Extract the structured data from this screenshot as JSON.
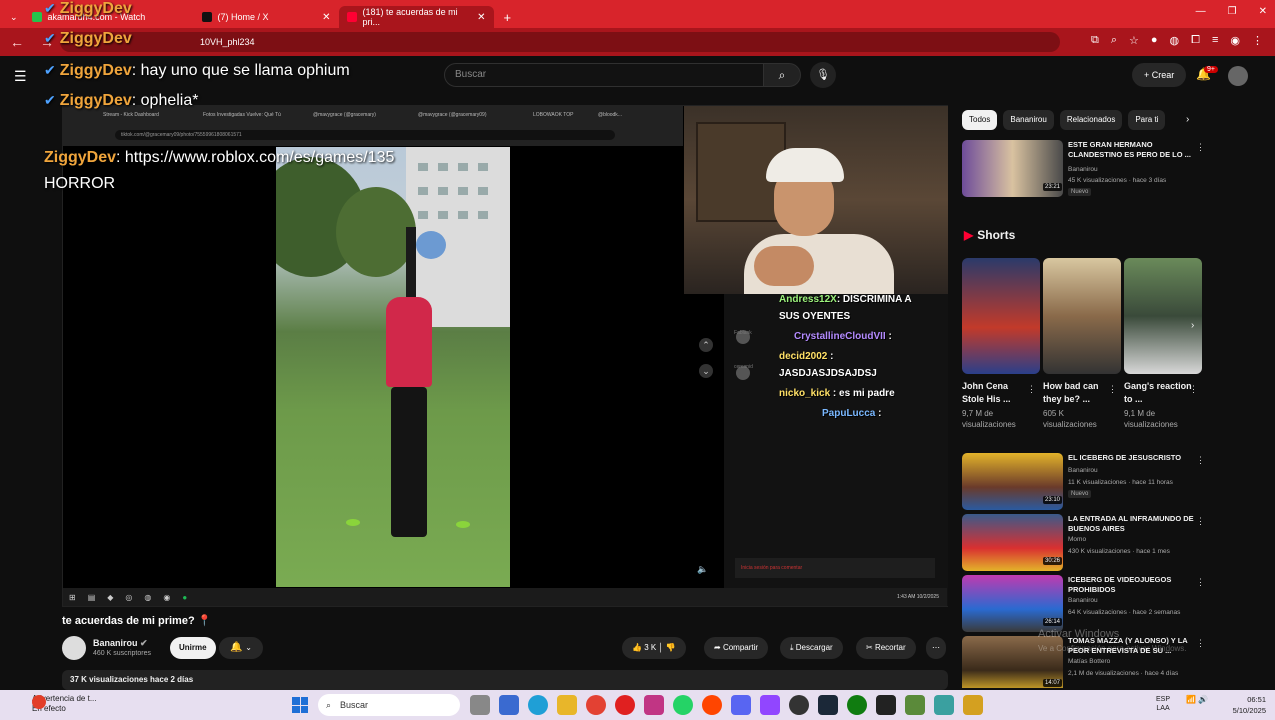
{
  "browser": {
    "tabs": [
      {
        "label": "akamaruh4.com - Watch",
        "color": "#27c24c"
      },
      {
        "label": "(7) Home / X",
        "color": "#111111"
      },
      {
        "label": "(181) te acuerdas de mi pri...",
        "color": "#ff0033"
      }
    ],
    "url_visible": "10VH_phl234"
  },
  "overlay_chat": [
    {
      "user": "ZiggyDev",
      "text": ""
    },
    {
      "user": "ZiggyDev",
      "text": ""
    },
    {
      "user": "ZiggyDev",
      "text": ": hay uno que se llama ophium"
    },
    {
      "user": "ZiggyDev",
      "text": ": ophelia*"
    },
    {
      "user": "ZiggyDev",
      "text": ": https://www.roblox.com/es/games/135"
    },
    {
      "user": "",
      "text": "HORROR"
    }
  ],
  "youtube": {
    "search_placeholder": "Buscar",
    "create_label": "Crear",
    "notif_badge": "9+"
  },
  "player": {
    "inner_tabs": [
      "Stream - Kick Dashboard",
      "Fotos Investigadas Vuelve: Qué Tú",
      "@mavygrace (@gracemary)",
      "@mavygrace (@gracemary09)",
      "LOBOWAOK TOP",
      "@bloodk..."
    ],
    "inner_url": "tiktok.com/@gracemary09/photo/75559961808061571",
    "chat": [
      {
        "user": "Andress12X",
        "text": ": DISCRIMINA A"
      },
      {
        "user": "",
        "text": "SUS OYENTES"
      },
      {
        "user": "CrystallineCloudVII",
        "text": " :"
      },
      {
        "user": "decid2002",
        "text": " :"
      },
      {
        "user": "",
        "text": "JASDJASJDSAJDSJ"
      },
      {
        "user": "nicko_kick",
        "text": " : es mi padre"
      },
      {
        "user": "PapuLucca",
        "text": " :"
      }
    ],
    "chat_ghost": [
      "Fabiank",
      "Crearnaid",
      "cercanid"
    ],
    "chat_input": "Inicia sesión para comentar",
    "clock": "1:43 AM 10/2/2025"
  },
  "video": {
    "title": "te acuerdas de mi prime?",
    "channel": "Bananirou",
    "subscribers": "460 K suscriptores",
    "join_label": "Unirme",
    "likes": "3 K",
    "share_label": "Compartir",
    "download_label": "Descargar",
    "clip_label": "Recortar",
    "stats": "37 K visualizaciones  hace 2 días"
  },
  "sidebar": {
    "chips": [
      "Todos",
      "Bananirou",
      "Relacionados",
      "Para ti"
    ],
    "top_rec": {
      "title": "Este GRAN HERMANO CLANDESTINO es PERO de lo ...",
      "channel": "Bananirou",
      "meta": "45 K visualizaciones · hace 3 días",
      "new": "Nuevo",
      "duration": "23:21"
    },
    "shorts_title": "Shorts",
    "shorts": [
      {
        "title": "John Cena Stole His ...",
        "views": "9,7 M de visualizaciones"
      },
      {
        "title": "How bad can they be? ...",
        "views": "605 K visualizaciones"
      },
      {
        "title": "Gang's reaction to ...",
        "views": "9,1 M de visualizaciones"
      }
    ],
    "recs": [
      {
        "title": "EL ICEBERG DE JESUSCRISTO",
        "channel": "Bananirou",
        "meta": "11 K visualizaciones · hace 11 horas",
        "new": "Nuevo",
        "duration": "23:10"
      },
      {
        "title": "LA ENTRADA AL INFRAMUNDO DE BUENOS AIRES",
        "channel": "Momo",
        "meta": "430 K visualizaciones · hace 1 mes",
        "new": "",
        "duration": "30:26"
      },
      {
        "title": "ICEBERG DE VIDEOJUEGOS PROHIBIDOS",
        "channel": "Bananirou",
        "meta": "64 K visualizaciones · hace 2 semanas",
        "new": "",
        "duration": "26:14"
      },
      {
        "title": "TOMAS MAZZA (Y ALONSO) Y LA PEOR ENTREVISTA DE SU ...",
        "channel": "Matías Bottero",
        "meta": "2,1 M de visualizaciones · hace 4 días",
        "new": "",
        "duration": "14:07"
      }
    ]
  },
  "watermark": {
    "line1": "Activar Windows",
    "line2": "Ve a Configuración para activar Windows."
  },
  "taskbar": {
    "warning_title": "Advertencia de t...",
    "warning_sub": "En efecto",
    "search": "Buscar",
    "lang1": "ESP",
    "lang2": "LAA",
    "time": "06:51",
    "date": "5/10/2025"
  }
}
